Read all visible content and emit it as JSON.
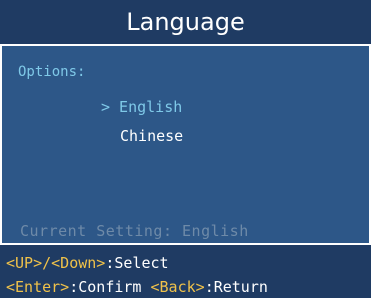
{
  "title": "Language",
  "options_label": "Options:",
  "options": [
    {
      "label": "> English",
      "selected": true
    },
    {
      "label": "Chinese",
      "selected": false
    }
  ],
  "current_setting": "Current Setting: English",
  "hints": {
    "line1": [
      {
        "text": "<UP>/<Down>",
        "type": "key"
      },
      {
        "text": ":Select",
        "type": "text"
      }
    ],
    "line2": [
      {
        "text": "<Enter>",
        "type": "key"
      },
      {
        "text": ":Confirm ",
        "type": "text"
      },
      {
        "text": "<Back>",
        "type": "key"
      },
      {
        "text": ":Return",
        "type": "text"
      }
    ]
  },
  "colors": {
    "title_bg": "#1f3b63",
    "panel_bg": "#2d5788",
    "accent": "#7fc9e8",
    "key": "#f0c24a",
    "muted": "#6e8aa8"
  }
}
